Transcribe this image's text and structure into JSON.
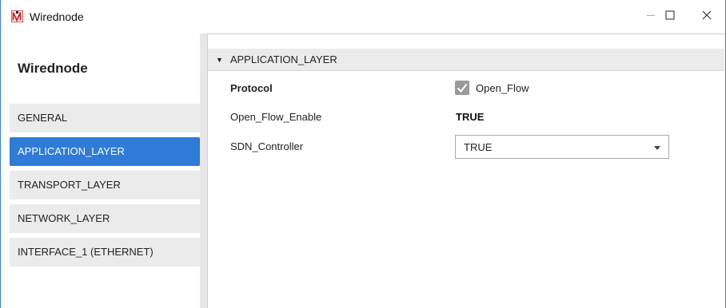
{
  "window": {
    "title": "Wirednode",
    "controls": {
      "minimize_icon": "minimize-icon",
      "maximize_icon": "maximize-icon",
      "close_icon": "close-icon"
    }
  },
  "sidebar": {
    "title": "Wirednode",
    "items": [
      {
        "label": "GENERAL",
        "active": false
      },
      {
        "label": "APPLICATION_LAYER",
        "active": true
      },
      {
        "label": "TRANSPORT_LAYER",
        "active": false
      },
      {
        "label": "NETWORK_LAYER",
        "active": false
      },
      {
        "label": "INTERFACE_1 (ETHERNET)",
        "active": false
      }
    ]
  },
  "content": {
    "section_title": "APPLICATION_LAYER",
    "protocol_label": "Protocol",
    "protocol_checkbox_label": "Open_Flow",
    "protocol_checked": true,
    "open_flow_enable_label": "Open_Flow_Enable",
    "open_flow_enable_value": "TRUE",
    "sdn_controller_label": "SDN_Controller",
    "sdn_controller_value": "TRUE"
  },
  "colors": {
    "accent": "#2f7bd8",
    "window_border": "#3c7fd6",
    "nav_bg": "#ebebeb"
  }
}
